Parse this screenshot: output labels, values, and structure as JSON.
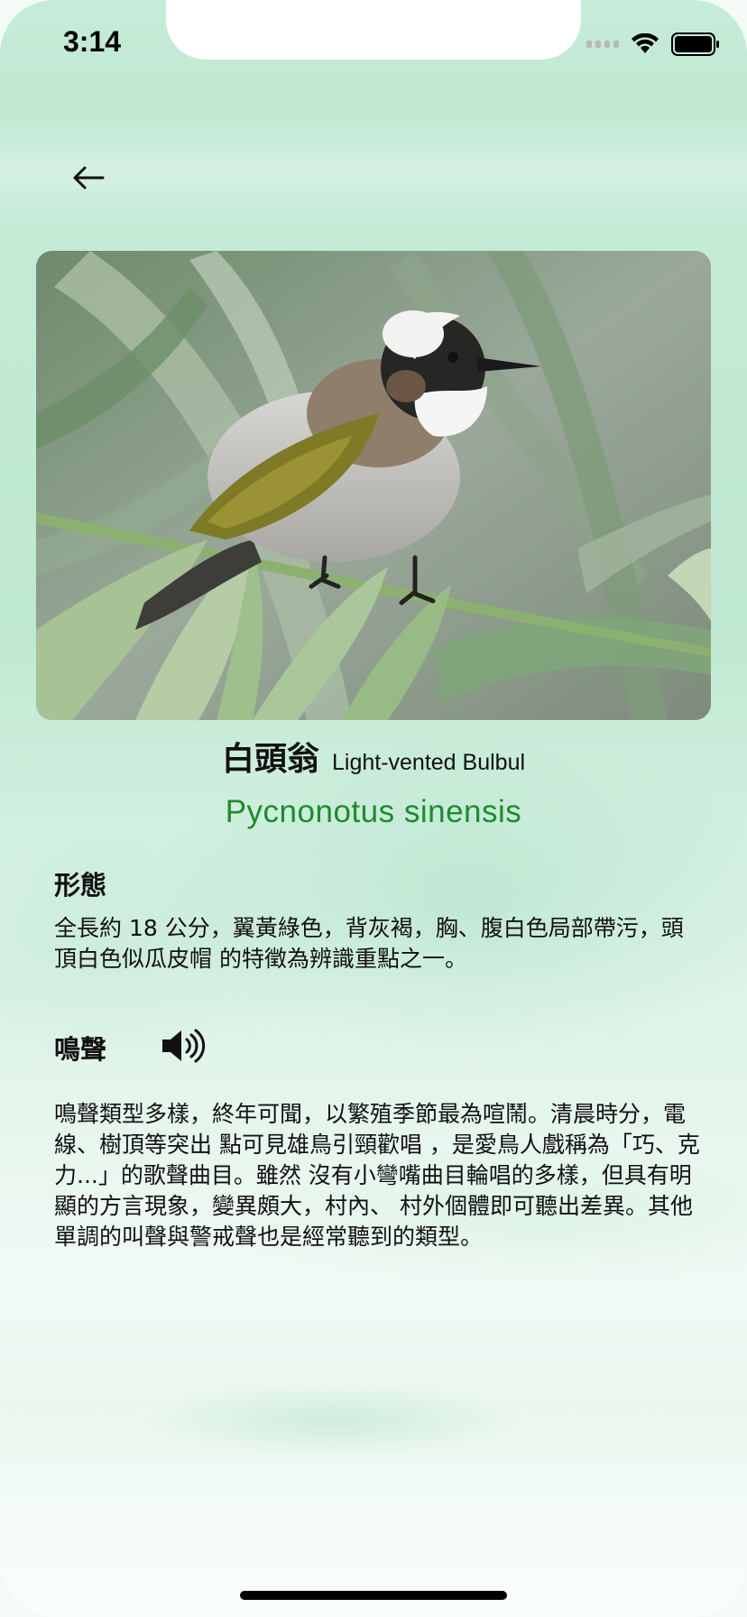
{
  "status_bar": {
    "time": "3:14"
  },
  "nav": {
    "back_icon": "arrow-left-icon"
  },
  "bird": {
    "name_zh": "白頭翁",
    "name_en": "Light-vented Bulbul",
    "scientific_name": "Pycnonotus sinensis",
    "photo_icon": "bird-photo"
  },
  "morphology": {
    "heading": "形態",
    "text": "全長約 18 公分，翼黃綠色，背灰褐，胸、腹白色局部帶污，頭頂白色似瓜皮帽 的特徵為辨識重點之一。"
  },
  "call": {
    "heading": "鳴聲",
    "sound_icon": "speaker-icon",
    "text": "鳴聲類型多樣，終年可聞，以繁殖季節最為喧鬧。清晨時分，電線、樹頂等突出 點可見雄鳥引頸歡唱 ，是愛鳥人戲稱為「巧、克力...」的歌聲曲目。雖然 沒有小彎嘴曲目輪唱的多樣，但具有明顯的方言現象，變異頗大，村內、 村外個體即可聽出差異。其他單調的叫聲與警戒聲也是經常聽到的類型。"
  },
  "colors": {
    "scientific_name": "#1e8a2e",
    "background": "#c7ecd9"
  }
}
